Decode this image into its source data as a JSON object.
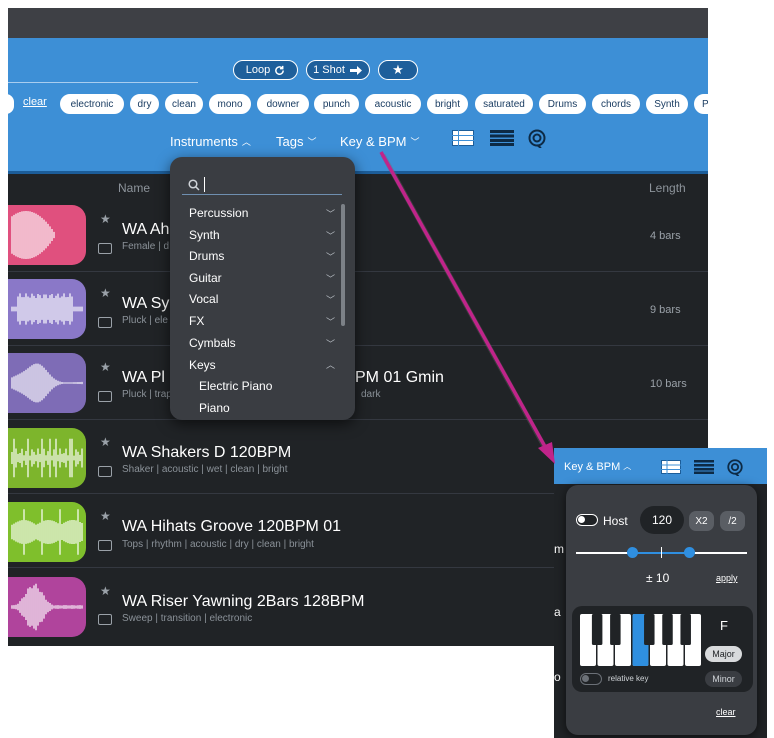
{
  "colors": {
    "accent": "#3d8fd6",
    "arrow": "#c0248a",
    "selected_key": "#2f8fe0",
    "wave_pink": "#e0507e",
    "wave_purple": "#8a78c8",
    "wave_lilac": "#7e6cb6",
    "wave_green": "#7db52c",
    "wave_lime": "#7fbf2c",
    "wave_magenta": "#b0449c"
  },
  "header": {
    "buttons": {
      "loop": "Loop",
      "one_shot": "1 Shot"
    },
    "clear": "clear",
    "tags": [
      "electronic",
      "dry",
      "clean",
      "mono",
      "downer",
      "punch",
      "acoustic",
      "bright",
      "saturated",
      "Drums",
      "chords",
      "Synth",
      "P"
    ],
    "nav": {
      "instruments": "Instruments",
      "tags": "Tags",
      "key_bpm": "Key & BPM"
    },
    "icons": [
      "list-view-icon",
      "compact-list-icon",
      "target-settings-icon",
      "refresh-icon",
      "arrow-right-icon",
      "star-icon"
    ]
  },
  "columns": {
    "name": "Name",
    "length": "Length"
  },
  "rows": [
    {
      "title": "WA Ah",
      "tags": "Female | d",
      "length": "4 bars"
    },
    {
      "title": "WA Sy",
      "tags": "Pluck | ele",
      "length": "9 bars"
    },
    {
      "title": "WA Pl",
      "title_tail": "PM 01 Gmin",
      "tags": "Pluck | trap",
      "tags_tail": "dark",
      "length": "10 bars"
    },
    {
      "title": "WA Shakers D 120BPM",
      "tags": "Shaker | acoustic | wet | clean | bright",
      "length": ""
    },
    {
      "title": "WA Hihats Groove 120BPM 01",
      "tags": "Tops | rhythm | acoustic | dry | clean | bright",
      "length": ""
    },
    {
      "title": "WA Riser Yawning 2Bars 128BPM",
      "tags": "Sweep | transition | electronic",
      "length": ""
    }
  ],
  "instruments_dropdown": {
    "search_placeholder": "",
    "items": [
      "Percussion",
      "Synth",
      "Drums",
      "Guitar",
      "Vocal",
      "FX",
      "Cymbals",
      "Keys"
    ],
    "subitems": [
      "Electric Piano",
      "Piano"
    ]
  },
  "key_bpm_panel": {
    "header_label": "Key & BPM",
    "host_label": "Host",
    "bpm": "120",
    "x2": "X2",
    "half": "/2",
    "tolerance": "± 10",
    "apply": "apply",
    "key": "F",
    "major": "Major",
    "minor": "Minor",
    "relative_key": "relative key",
    "clear": "clear",
    "selected_key_index": 5
  }
}
